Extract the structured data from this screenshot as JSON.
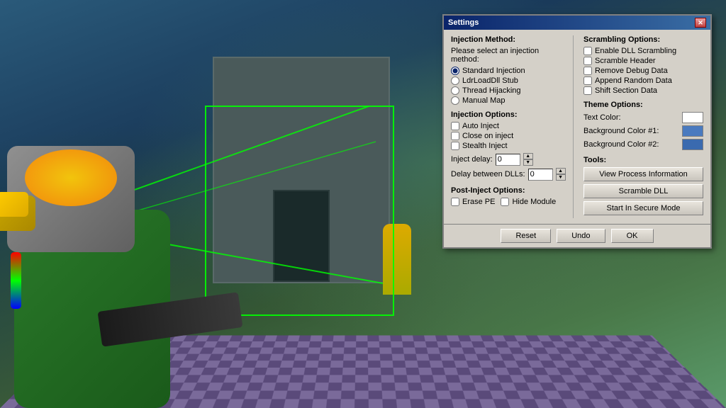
{
  "game": {
    "bg_color": "#1a3a4a"
  },
  "dialog": {
    "title": "Settings",
    "close_label": "✕",
    "injection_method": {
      "label": "Injection Method:",
      "sublabel": "Please select an injection method:",
      "options": [
        {
          "id": "standard",
          "label": "Standard Injection",
          "checked": true
        },
        {
          "id": "ldrload",
          "label": "LdrLoadDll Stub",
          "checked": false
        },
        {
          "id": "thread",
          "label": "Thread Hijacking",
          "checked": false
        },
        {
          "id": "manual",
          "label": "Manual Map",
          "checked": false
        }
      ]
    },
    "injection_options": {
      "label": "Injection Options:",
      "checkboxes": [
        {
          "id": "auto_inject",
          "label": "Auto Inject",
          "checked": false
        },
        {
          "id": "close_on_inject",
          "label": "Close on inject",
          "checked": false
        },
        {
          "id": "stealth_inject",
          "label": "Stealth Inject",
          "checked": false
        }
      ],
      "inject_delay_label": "Inject delay:",
      "inject_delay_value": "0",
      "delay_between_label": "Delay between DLLs:",
      "delay_between_value": "0"
    },
    "post_inject": {
      "label": "Post-Inject Options:",
      "checkboxes": [
        {
          "id": "erase_pe",
          "label": "Erase PE",
          "checked": false
        },
        {
          "id": "hide_module",
          "label": "Hide Module",
          "checked": false
        }
      ]
    },
    "scrambling_options": {
      "label": "Scrambling Options:",
      "checkboxes": [
        {
          "id": "enable_dll_scrambling",
          "label": "Enable DLL Scrambling",
          "checked": false
        },
        {
          "id": "scramble_header",
          "label": "Scramble Header",
          "checked": false
        },
        {
          "id": "remove_debug",
          "label": "Remove Debug Data",
          "checked": false
        },
        {
          "id": "append_random",
          "label": "Append Random Data",
          "checked": false
        },
        {
          "id": "shift_section",
          "label": "Shift Section Data",
          "checked": false
        }
      ]
    },
    "theme_options": {
      "label": "Theme Options:",
      "text_color_label": "Text Color:",
      "text_color": "#ffffff",
      "bg_color1_label": "Background Color #1:",
      "bg_color1": "#4a7abf",
      "bg_color2_label": "Background Color #2:",
      "bg_color2": "#3a6aaf"
    },
    "tools": {
      "label": "Tools:",
      "buttons": [
        {
          "id": "view_process",
          "label": "View Process Information"
        },
        {
          "id": "scramble_dll",
          "label": "Scramble DLL"
        },
        {
          "id": "secure_mode",
          "label": "Start In Secure Mode"
        }
      ]
    },
    "footer": {
      "buttons": [
        {
          "id": "reset",
          "label": "Reset"
        },
        {
          "id": "undo",
          "label": "Undo"
        },
        {
          "id": "ok",
          "label": "OK"
        }
      ]
    }
  }
}
